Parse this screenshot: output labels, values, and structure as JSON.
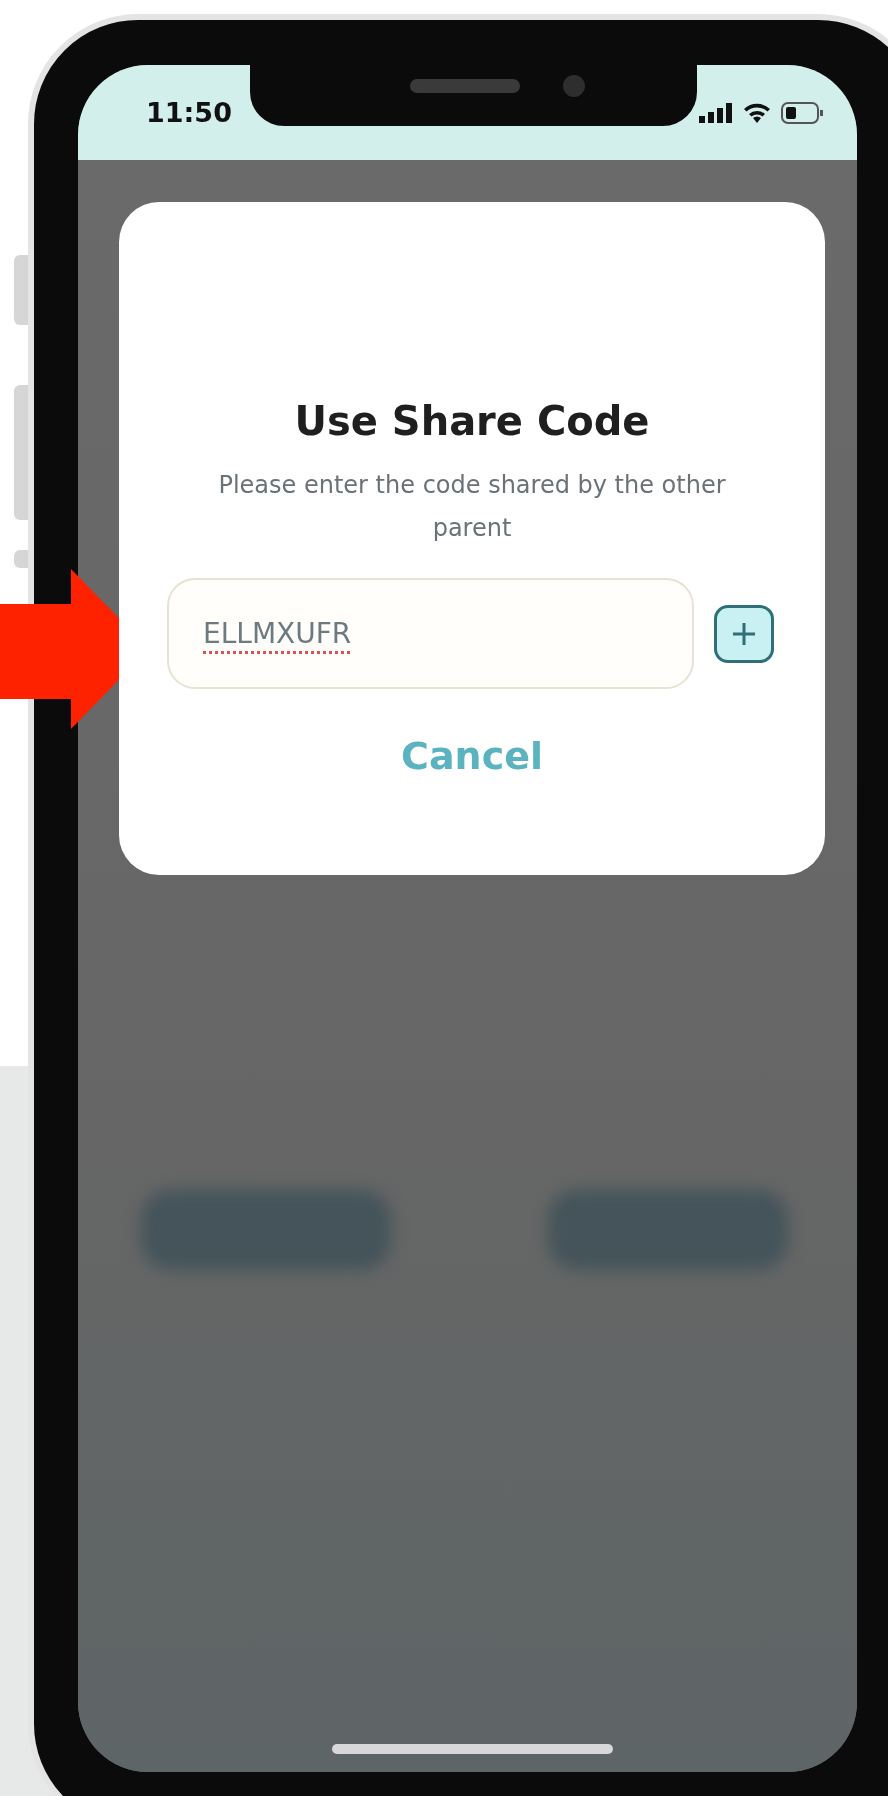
{
  "status_bar": {
    "time": "11:50"
  },
  "dialog": {
    "title": "Use Share Code",
    "message": "Please enter the code shared by the other parent",
    "code_field": {
      "value": "ELLMXUFR",
      "misspelled": true
    },
    "cancel_label": "Cancel"
  }
}
